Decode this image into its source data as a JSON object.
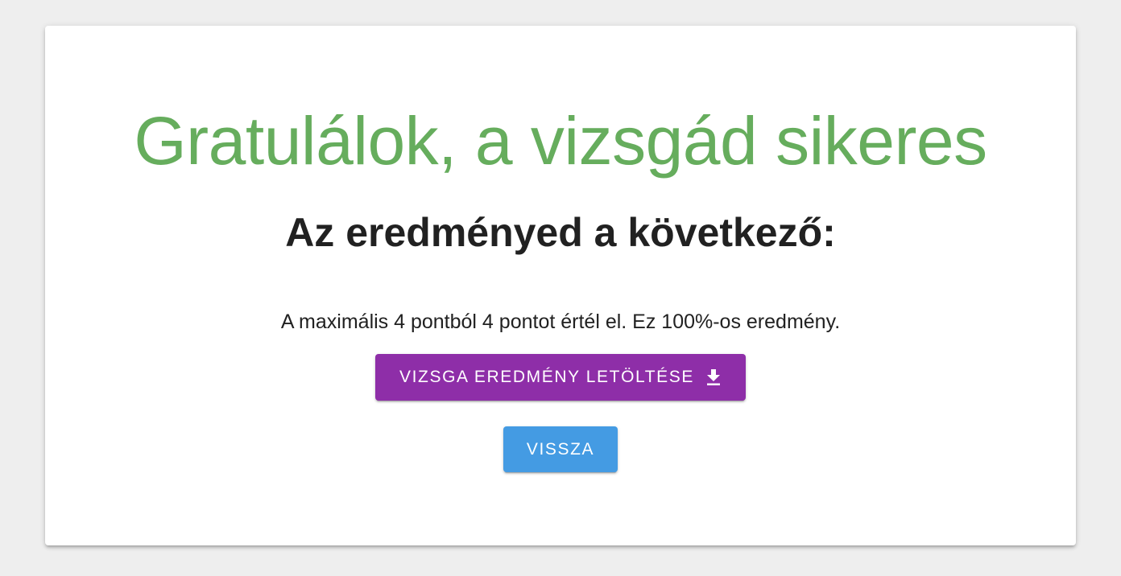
{
  "result": {
    "title": "Gratulálok, a vizsgád sikeres",
    "subtitle": "Az eredményed a következő:",
    "summary": "A maximális 4 pontból 4 pontot értél el. Ez 100%-os eredmény.",
    "max_points": 4,
    "earned_points": 4,
    "percent": 100
  },
  "actions": {
    "download_label": "Vizsga eredmény letöltése",
    "download_icon": "download-icon",
    "back_label": "Vissza"
  },
  "colors": {
    "title": "#66ad5d",
    "download_button": "#8e2ea8",
    "back_button": "#449be3",
    "background": "#eeeeee"
  }
}
